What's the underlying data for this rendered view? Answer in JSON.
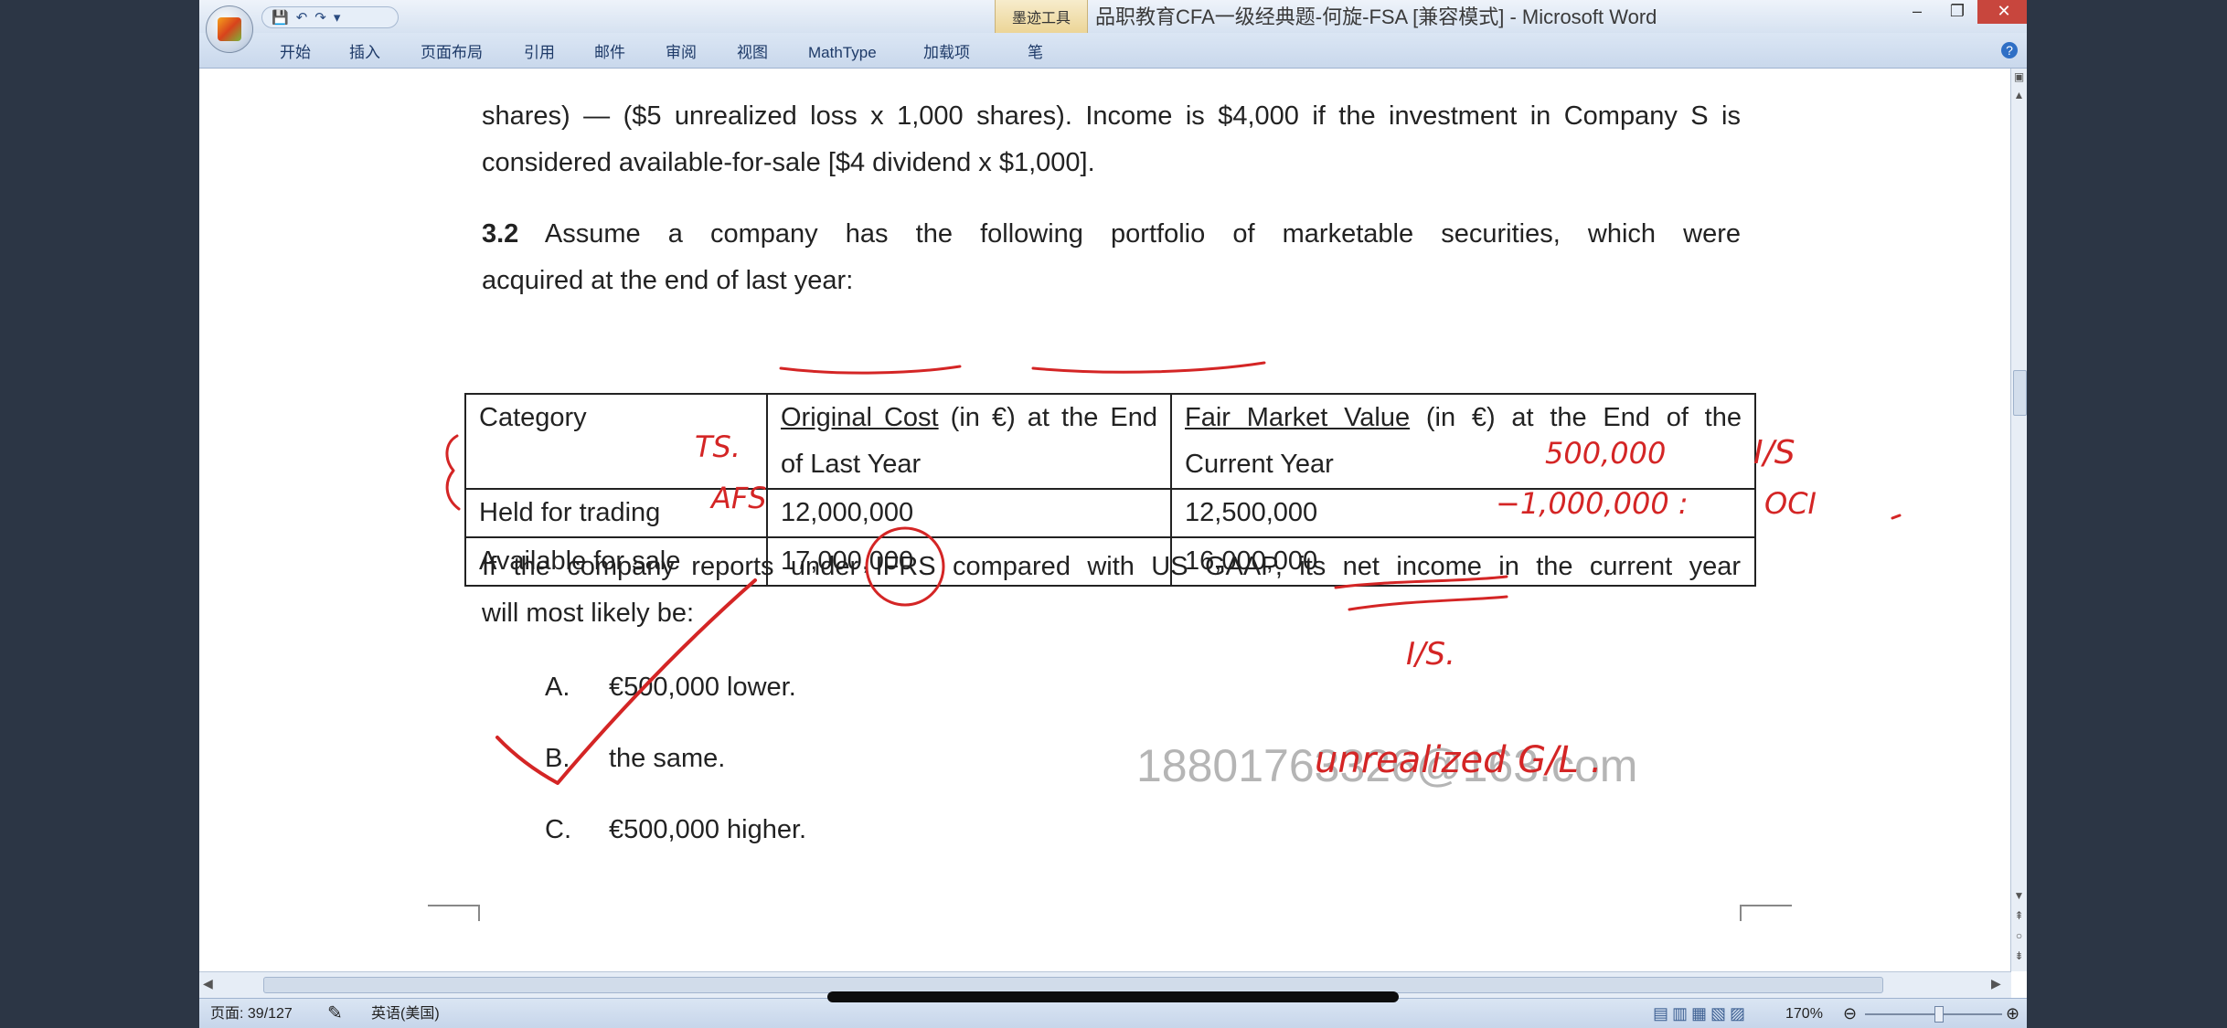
{
  "window": {
    "title": "品职教育CFA一级经典题-何旋-FSA [兼容模式] - Microsoft Word",
    "tools_tab": "墨迹工具",
    "controls": {
      "minimize": "–",
      "restore": "❐",
      "close": "✕"
    }
  },
  "ribbon": {
    "tabs": [
      "开始",
      "插入",
      "页面布局",
      "引用",
      "邮件",
      "审阅",
      "视图",
      "MathType",
      "加载项",
      "笔"
    ],
    "help": "?"
  },
  "document": {
    "intro_lines": [
      "shares) — ($5 unrealized loss x 1,000 shares). Income is $4,000 if the investment in Company S is",
      "considered available-for-sale [$4 dividend x $1,000]."
    ],
    "question_number": "3.2",
    "question_line1": "Assume a company has the following portfolio of marketable securities, which were",
    "question_line2": "acquired at the end of last year:",
    "table": {
      "headers": {
        "category": "Category",
        "cost_underlined": "Original Cost",
        "cost_rest": " (in €) at the End of Last Year",
        "fair_underlined": "Fair Market Value",
        "fair_rest": " (in €) at the End of the Current Year"
      },
      "rows": [
        {
          "category": "Held for trading",
          "cost": "12,000,000",
          "fair": "12,500,000"
        },
        {
          "category": "Available for sale",
          "cost": "17,000,000",
          "fair": "16,000,000"
        }
      ]
    },
    "prompt_line1_a": "If the company reports under",
    "prompt_ifrs": "IFRS",
    "prompt_line1_b": "compared with US GAAP, its net income in the current year",
    "prompt_line2": "will most likely be:",
    "choices": [
      {
        "letter": "A.",
        "text": "€500,000 lower."
      },
      {
        "letter": "B.",
        "text": "the same."
      },
      {
        "letter": "C.",
        "text": "€500,000 higher."
      }
    ],
    "watermark": "18801763326@163.com"
  },
  "annotations": {
    "ts_label": "TS.",
    "afs_label": "AFS",
    "gain": "500,000",
    "loss": "−1,000,000 :",
    "is_label": "I/S",
    "oci_label": "OCI",
    "is_note": "I/S.",
    "unrealized": "unrealized G/L ."
  },
  "statusbar": {
    "page": "页面: 39/127",
    "language": "英语(美国)",
    "zoom": "170%"
  },
  "colors": {
    "ink": "#d42525",
    "titlebar": "#dbe6f4",
    "text": "#222222"
  }
}
